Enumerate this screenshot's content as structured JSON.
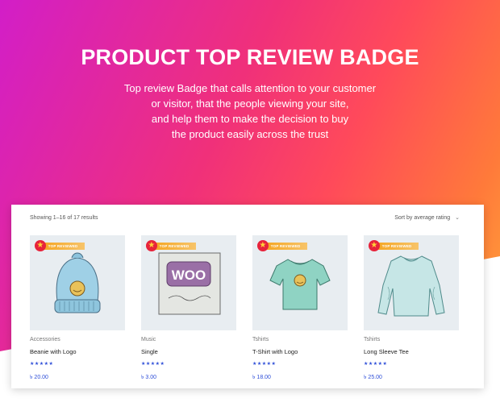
{
  "hero": {
    "title": "PRODUCT TOP REVIEW BADGE",
    "subtitle_lines": [
      "Top review Badge that calls attention to your customer",
      "or visitor, that the people viewing your site,",
      "and help them to make the decision to buy",
      "the product easily across the trust"
    ]
  },
  "shop": {
    "result_count": "Showing 1–16 of 17 results",
    "sort_label": "Sort by average rating",
    "badge_label": "TOP REVIEWED",
    "rating_stars": "★★★★★",
    "products": [
      {
        "category": "Accessories",
        "name": "Beanie with Logo",
        "price": "৳ 20.00",
        "image": "beanie-image"
      },
      {
        "category": "Music",
        "name": "Single",
        "price": "৳ 3.00",
        "image": "woo-single-image"
      },
      {
        "category": "Tshirts",
        "name": "T-Shirt with Logo",
        "price": "৳ 18.00",
        "image": "tshirt-image"
      },
      {
        "category": "Tshirts",
        "name": "Long Sleeve Tee",
        "price": "৳ 25.00",
        "image": "long-sleeve-image"
      }
    ]
  },
  "colors": {
    "gradient_start": "#d21ec8",
    "gradient_mid": "#ff4a5a",
    "gradient_end": "#ffb33a",
    "badge_red": "#e7233b",
    "badge_orange": "#f5a623",
    "link_blue": "#2f4fd8"
  },
  "text_logo": "WOO"
}
